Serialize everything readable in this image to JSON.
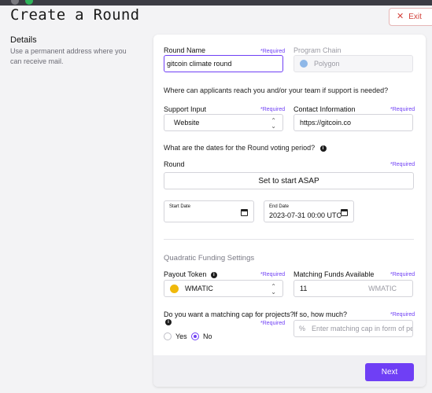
{
  "header": {
    "title": "Create a Round",
    "exit_label": "Exit"
  },
  "details": {
    "heading": "Details",
    "description": "Use a permanent address where you can receive mail."
  },
  "form": {
    "round_name": {
      "label": "Round Name",
      "required": "*Required",
      "value": "gitcoin climate round"
    },
    "program_chain": {
      "label": "Program Chain",
      "value": "Polygon"
    },
    "support_question": "Where can applicants reach you and/or your team if support is needed?",
    "support_input": {
      "label": "Support Input",
      "required": "*Required",
      "value": "Website"
    },
    "contact_info": {
      "label": "Contact Information",
      "required": "*Required",
      "value": "https://gitcoin.co"
    },
    "dates_question": "What are the dates for the Round voting period?",
    "round": {
      "label": "Round",
      "required": "*Required",
      "value": "Set to start ASAP"
    },
    "start_date": {
      "label": "Start Date",
      "value": ""
    },
    "end_date": {
      "label": "End Date",
      "value": "2023-07-31 00:00 UTC"
    },
    "qf_heading": "Quadratic Funding Settings",
    "payout_token": {
      "label": "Payout Token",
      "required": "*Required",
      "value": "WMATIC"
    },
    "matching_funds": {
      "label": "Matching Funds Available",
      "required": "*Required",
      "value": "11",
      "unit": "WMATIC"
    },
    "matching_cap_question": "Do you want a matching cap for projects?",
    "matching_cap_required": "*Required",
    "matching_cap_options": [
      "Yes",
      "No"
    ],
    "matching_cap_selected": "No",
    "matching_cap_amount": {
      "label": "If so, how much?",
      "required": "*Required",
      "prefix": "%",
      "placeholder": "Enter matching cap in form of pen"
    }
  },
  "footer": {
    "next_label": "Next"
  },
  "colors": {
    "accent": "#6f3ff5",
    "exit": "#d2413a",
    "polygon": "#8fb8e8",
    "wmatic": "#f0b90b"
  }
}
